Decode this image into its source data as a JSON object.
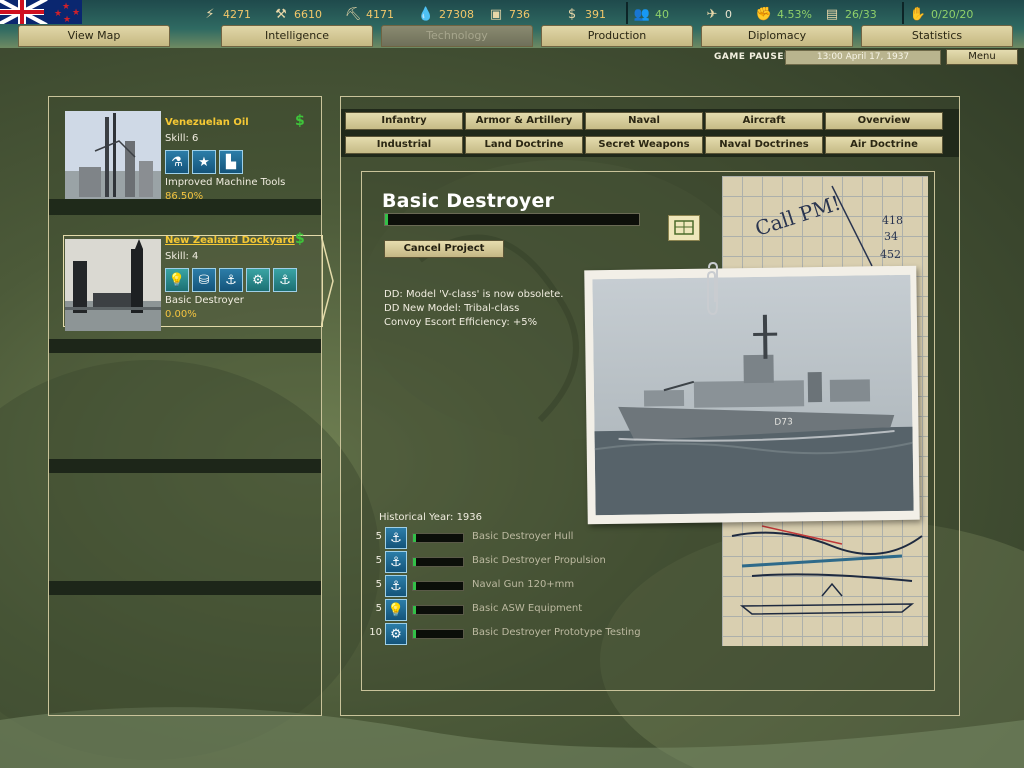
{
  "resources": {
    "energy": {
      "icon": "energy-icon",
      "value": "4271"
    },
    "metal": {
      "icon": "metal-icon",
      "value": "6610"
    },
    "rare_materials": {
      "icon": "rare-materials-icon",
      "value": "4171"
    },
    "oil": {
      "icon": "oil-icon",
      "value": "27308"
    },
    "supplies": {
      "icon": "supplies-icon",
      "value": "736"
    },
    "money": {
      "icon": "money-icon",
      "value": "391"
    },
    "manpower": {
      "icon": "manpower-icon",
      "value": "40"
    },
    "transports": {
      "icon": "transports-icon",
      "value": "0"
    },
    "dissent": {
      "icon": "dissent-icon",
      "value": "4.53%"
    },
    "ic": {
      "icon": "industry-icon",
      "value": "26/33"
    },
    "diplomacy": {
      "icon": "diplomacy-icon",
      "value": "0/20/20"
    }
  },
  "nav_tabs": [
    "View Map",
    "Intelligence",
    "Technology",
    "Production",
    "Diplomacy",
    "Statistics"
  ],
  "active_tab": "Technology",
  "status": {
    "paused": "GAME PAUSED",
    "date": "13:00 April 17, 1937",
    "menu": "Menu"
  },
  "teams": [
    {
      "name": "Venezuelan Oil",
      "skill": "Skill: 6",
      "task": "Improved Machine Tools",
      "progress": "86.50%",
      "dollar": "$",
      "icons": [
        "flask-icon",
        "star-icon",
        "factory-icon"
      ]
    },
    {
      "name": "New Zealand Dockyard",
      "skill": "Skill: 4",
      "task": "Basic Destroyer",
      "progress": "0.00%",
      "dollar": "$",
      "icons": [
        "bulb-icon",
        "engine-icon",
        "anchor-icon",
        "gears-icon",
        "anchor-gun-icon"
      ]
    }
  ],
  "categories_row1": [
    "Infantry",
    "Armor & Artillery",
    "Naval",
    "Aircraft",
    "Overview"
  ],
  "categories_row2": [
    "Industrial",
    "Land Doctrine",
    "Secret Weapons",
    "Naval Doctrines",
    "Air Doctrine"
  ],
  "tech": {
    "title": "Basic Destroyer",
    "progress": 0.01,
    "cancel_label": "Cancel Project",
    "effects": [
      "DD: Model 'V-class' is now obsolete.",
      "DD New Model: Tribal-class",
      "Convoy Escort Efficiency: +5%"
    ],
    "historical_year": "Historical Year: 1936",
    "ship_hull_number": "D73",
    "note_text": "Call PM!",
    "note_numbers": [
      "418",
      "34",
      "452"
    ],
    "components": [
      {
        "difficulty": "5",
        "icon": "anchor-icon",
        "name": "Basic Destroyer Hull",
        "progress": 0.05
      },
      {
        "difficulty": "5",
        "icon": "anchor-icon",
        "name": "Basic Destroyer Propulsion",
        "progress": 0.05
      },
      {
        "difficulty": "5",
        "icon": "anchor-gun-icon",
        "name": "Naval Gun 120+mm",
        "progress": 0.05
      },
      {
        "difficulty": "5",
        "icon": "bulb-icon",
        "name": "Basic ASW Equipment",
        "progress": 0.05
      },
      {
        "difficulty": "10",
        "icon": "gears-icon",
        "name": "Basic Destroyer Prototype Testing",
        "progress": 0.05
      }
    ]
  }
}
